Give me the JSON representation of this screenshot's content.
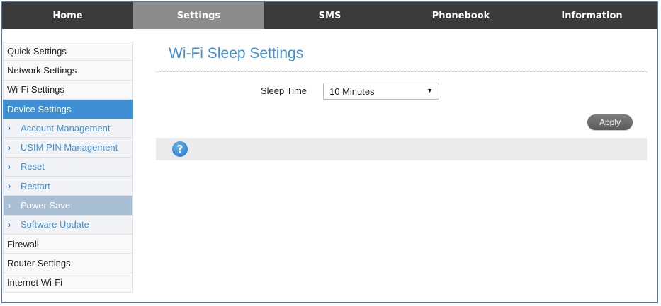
{
  "topnav": {
    "items": [
      {
        "label": "Home"
      },
      {
        "label": "Settings"
      },
      {
        "label": "SMS"
      },
      {
        "label": "Phonebook"
      },
      {
        "label": "Information"
      }
    ],
    "active_index": 1
  },
  "sidebar": {
    "items": [
      {
        "label": "Quick Settings"
      },
      {
        "label": "Network Settings"
      },
      {
        "label": "Wi-Fi Settings"
      },
      {
        "label": "Device Settings"
      },
      {
        "label": "Account Management"
      },
      {
        "label": "USIM PIN Management"
      },
      {
        "label": "Reset"
      },
      {
        "label": "Restart"
      },
      {
        "label": "Power Save"
      },
      {
        "label": "Software Update"
      },
      {
        "label": "Firewall"
      },
      {
        "label": "Router Settings"
      },
      {
        "label": "Internet Wi-Fi"
      }
    ],
    "chevron": "›"
  },
  "main": {
    "title": "Wi-Fi Sleep Settings",
    "sleep_time_label": "Sleep Time",
    "sleep_time_value": "10 Minutes",
    "apply_label": "Apply",
    "help_glyph": "?"
  },
  "colors": {
    "accent": "#3f8fd4",
    "nav_bg": "#3a3a3a",
    "nav_active": "#8c8c8c",
    "selected_sub": "#a9c0d4"
  },
  "icons": {
    "dropdown": "chevron-down-icon",
    "help": "help-icon"
  }
}
